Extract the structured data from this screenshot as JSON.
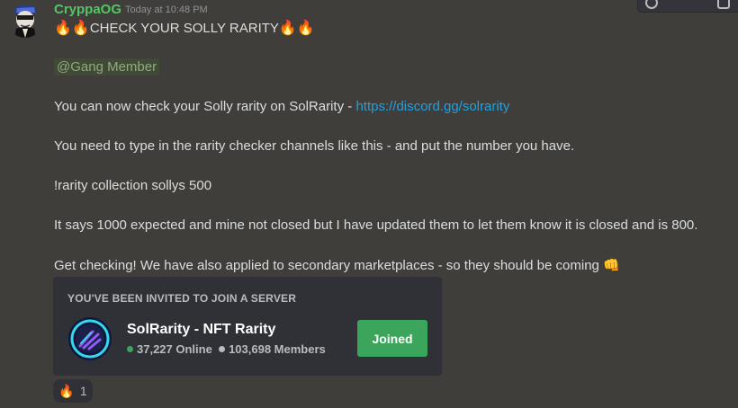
{
  "message": {
    "username": "CryppaOG",
    "timestamp": "Today at 10:48 PM",
    "title": "CHECK YOUR SOLLY RARITY",
    "fire_emoji": "🔥🔥",
    "mention": "@Gang Member",
    "line1_text": "You can now check your Solly rarity on SolRarity - ",
    "line1_link": "https://discord.gg/solrarity",
    "line2": "You need to type in the rarity checker channels like this - and put the number you have.",
    "line3": "!rarity collection sollys 500",
    "line4": "It says 1000 expected and mine not closed  but I have updated them to let them know it is closed and is 800.",
    "line5": "Get checking! We have also applied to secondary marketplaces - so they should be coming",
    "fist_emoji": "👊"
  },
  "invite": {
    "header": "YOU'VE BEEN INVITED TO JOIN A SERVER",
    "server_name": "SolRarity - NFT Rarity",
    "online": "37,227 Online",
    "members": "103,698 Members",
    "button": "Joined"
  },
  "reaction": {
    "emoji": "🔥",
    "count": "1"
  },
  "colors": {
    "username": "#55c466",
    "link": "#22a0e0",
    "joined_button": "#3ba55c",
    "online_dot": "#3ba55c",
    "members_dot": "#b9bbbe"
  },
  "icons": [
    "avatar",
    "server-icon",
    "toolbar-icon"
  ]
}
